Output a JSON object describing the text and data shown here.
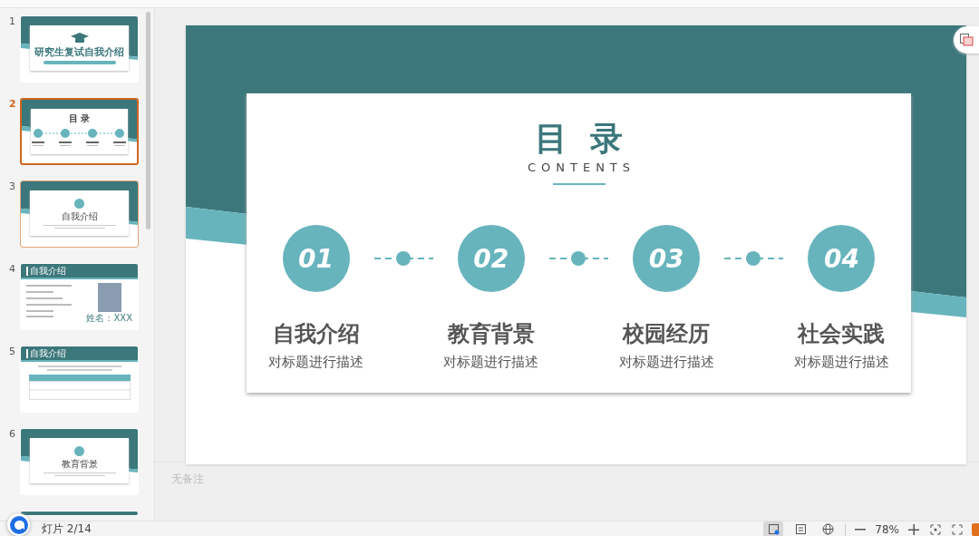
{
  "slides_panel": {
    "slides": [
      {
        "kind": "cover",
        "number": "1",
        "selected": false,
        "hovered": false,
        "title": "研究生复试自我介绍"
      },
      {
        "kind": "contents",
        "number": "2",
        "selected": true,
        "hovered": false,
        "title": "目 录"
      },
      {
        "kind": "section",
        "number": "3",
        "selected": false,
        "hovered": true,
        "title": "自我介绍"
      },
      {
        "kind": "profile",
        "number": "4",
        "selected": false,
        "hovered": false,
        "title": "自我介绍",
        "caption": "姓名：XXX"
      },
      {
        "kind": "table",
        "number": "5",
        "selected": false,
        "hovered": false,
        "title": "自我介绍"
      },
      {
        "kind": "section",
        "number": "6",
        "selected": false,
        "hovered": false,
        "title": "教育背景"
      },
      {
        "kind": "cut",
        "selected": false,
        "hovered": false
      }
    ]
  },
  "slide": {
    "title": "目  录",
    "subtitle": "CONTENTS",
    "items": [
      {
        "number": "01",
        "heading": "自我介绍",
        "description": "对标题进行描述"
      },
      {
        "number": "02",
        "heading": "教育背景",
        "description": "对标题进行描述"
      },
      {
        "number": "03",
        "heading": "校园经历",
        "description": "对标题进行描述"
      },
      {
        "number": "04",
        "heading": "社会实践",
        "description": "对标题进行描述"
      }
    ]
  },
  "notes": {
    "placeholder": "无备注"
  },
  "status_bar": {
    "slide_counter": "灯片 2/14",
    "views": [
      {
        "kind": "normal",
        "selected": true
      },
      {
        "kind": "notes",
        "selected": false
      },
      {
        "kind": "web",
        "selected": false
      }
    ],
    "zoom": "78%"
  }
}
